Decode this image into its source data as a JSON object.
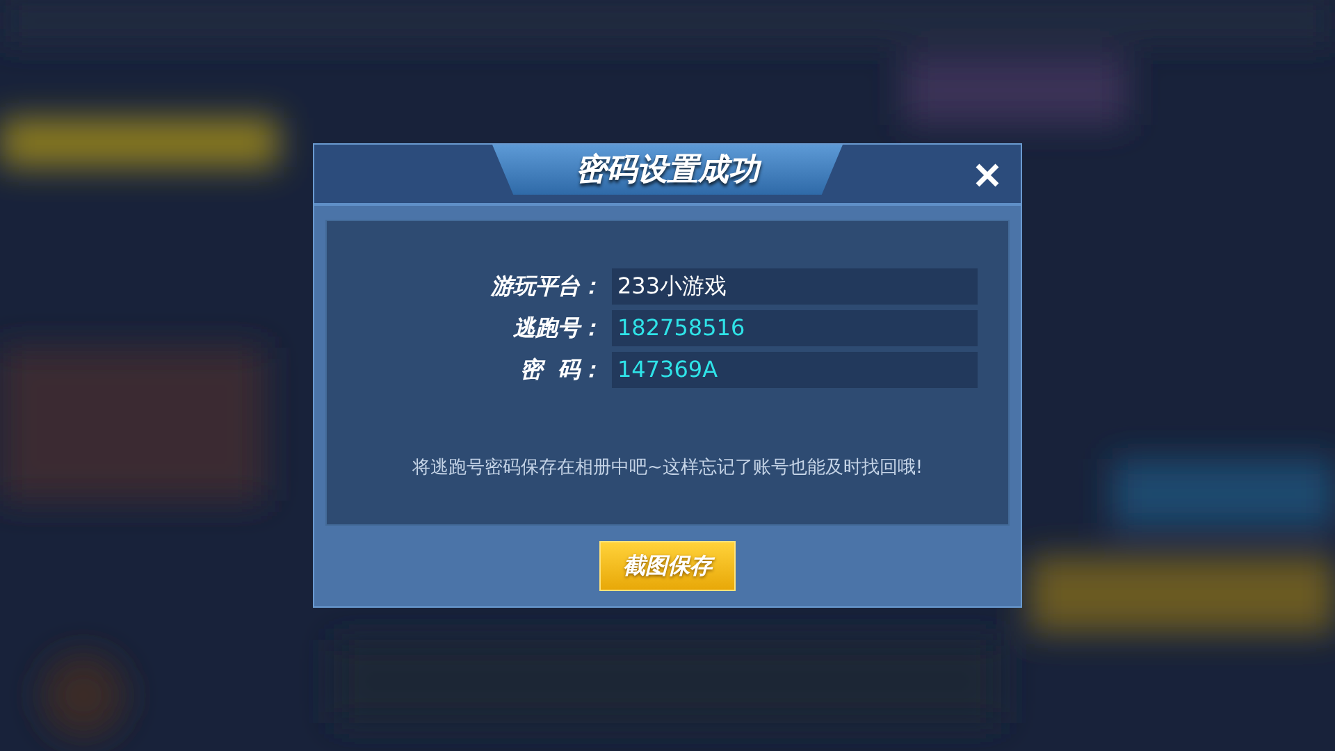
{
  "dialog": {
    "title": "密码设置成功",
    "fields": [
      {
        "label": "游玩平台：",
        "value": "233小游戏",
        "color": "#ffffff"
      },
      {
        "label": "逃跑号：",
        "value": "182758516",
        "color": "#2fe3e8"
      },
      {
        "label": "密  码：",
        "value": "147369A",
        "color": "#2fe3e8"
      }
    ],
    "note": "将逃跑号密码保存在相册中吧~这样忘记了账号也能及时找回哦!",
    "button": "截图保存"
  }
}
